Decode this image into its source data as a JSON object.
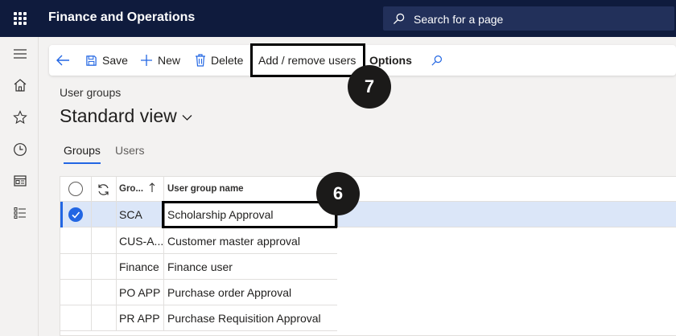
{
  "app": {
    "title": "Finance and Operations"
  },
  "search": {
    "placeholder": "Search for a page"
  },
  "toolbar": {
    "save_label": "Save",
    "new_label": "New",
    "delete_label": "Delete",
    "add_remove_users_label": "Add / remove users",
    "options_label": "Options"
  },
  "callouts": {
    "step_7": "7",
    "step_6": "6"
  },
  "page": {
    "breadcrumb": "User groups",
    "view_title": "Standard view"
  },
  "tabs": [
    {
      "label": "Groups",
      "active": true
    },
    {
      "label": "Users",
      "active": false
    }
  ],
  "grid": {
    "columns": {
      "group": "Gro...",
      "name": "User group name"
    },
    "rows": [
      {
        "group": "SCA",
        "name": "Scholarship Approval",
        "selected": true
      },
      {
        "group": "CUS-A...",
        "name": "Customer master approval",
        "selected": false
      },
      {
        "group": "Finance",
        "name": "Finance user",
        "selected": false
      },
      {
        "group": "PO APP",
        "name": "Purchase order Approval",
        "selected": false
      },
      {
        "group": "PR APP",
        "name": "Purchase Requisition Approval",
        "selected": false
      }
    ]
  },
  "colors": {
    "topbar": "#0f1b3d",
    "accent": "#2266e3",
    "selected_row": "#dbe6f8"
  },
  "icons": [
    "waffle-icon",
    "search-icon",
    "hamburger-icon",
    "home-icon",
    "star-icon",
    "clock-icon",
    "workspace-icon",
    "list-icon",
    "back-arrow-icon",
    "save-icon",
    "plus-icon",
    "trash-icon",
    "refresh-icon",
    "sort-up-icon",
    "chevron-down-icon",
    "check-icon"
  ]
}
